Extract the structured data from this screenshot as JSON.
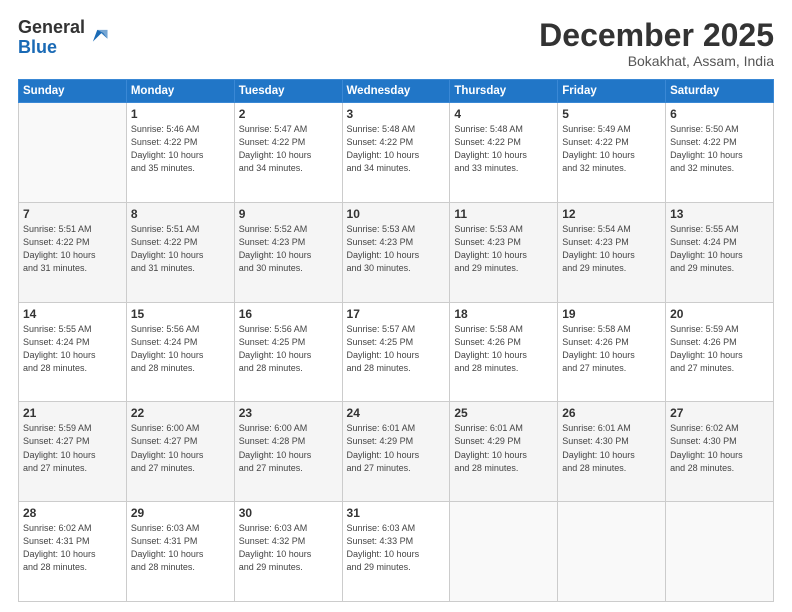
{
  "logo": {
    "general": "General",
    "blue": "Blue"
  },
  "header": {
    "month": "December 2025",
    "location": "Bokakhat, Assam, India"
  },
  "weekdays": [
    "Sunday",
    "Monday",
    "Tuesday",
    "Wednesday",
    "Thursday",
    "Friday",
    "Saturday"
  ],
  "weeks": [
    [
      {
        "day": "",
        "info": ""
      },
      {
        "day": "1",
        "info": "Sunrise: 5:46 AM\nSunset: 4:22 PM\nDaylight: 10 hours\nand 35 minutes."
      },
      {
        "day": "2",
        "info": "Sunrise: 5:47 AM\nSunset: 4:22 PM\nDaylight: 10 hours\nand 34 minutes."
      },
      {
        "day": "3",
        "info": "Sunrise: 5:48 AM\nSunset: 4:22 PM\nDaylight: 10 hours\nand 34 minutes."
      },
      {
        "day": "4",
        "info": "Sunrise: 5:48 AM\nSunset: 4:22 PM\nDaylight: 10 hours\nand 33 minutes."
      },
      {
        "day": "5",
        "info": "Sunrise: 5:49 AM\nSunset: 4:22 PM\nDaylight: 10 hours\nand 32 minutes."
      },
      {
        "day": "6",
        "info": "Sunrise: 5:50 AM\nSunset: 4:22 PM\nDaylight: 10 hours\nand 32 minutes."
      }
    ],
    [
      {
        "day": "7",
        "info": "Sunrise: 5:51 AM\nSunset: 4:22 PM\nDaylight: 10 hours\nand 31 minutes."
      },
      {
        "day": "8",
        "info": "Sunrise: 5:51 AM\nSunset: 4:22 PM\nDaylight: 10 hours\nand 31 minutes."
      },
      {
        "day": "9",
        "info": "Sunrise: 5:52 AM\nSunset: 4:23 PM\nDaylight: 10 hours\nand 30 minutes."
      },
      {
        "day": "10",
        "info": "Sunrise: 5:53 AM\nSunset: 4:23 PM\nDaylight: 10 hours\nand 30 minutes."
      },
      {
        "day": "11",
        "info": "Sunrise: 5:53 AM\nSunset: 4:23 PM\nDaylight: 10 hours\nand 29 minutes."
      },
      {
        "day": "12",
        "info": "Sunrise: 5:54 AM\nSunset: 4:23 PM\nDaylight: 10 hours\nand 29 minutes."
      },
      {
        "day": "13",
        "info": "Sunrise: 5:55 AM\nSunset: 4:24 PM\nDaylight: 10 hours\nand 29 minutes."
      }
    ],
    [
      {
        "day": "14",
        "info": "Sunrise: 5:55 AM\nSunset: 4:24 PM\nDaylight: 10 hours\nand 28 minutes."
      },
      {
        "day": "15",
        "info": "Sunrise: 5:56 AM\nSunset: 4:24 PM\nDaylight: 10 hours\nand 28 minutes."
      },
      {
        "day": "16",
        "info": "Sunrise: 5:56 AM\nSunset: 4:25 PM\nDaylight: 10 hours\nand 28 minutes."
      },
      {
        "day": "17",
        "info": "Sunrise: 5:57 AM\nSunset: 4:25 PM\nDaylight: 10 hours\nand 28 minutes."
      },
      {
        "day": "18",
        "info": "Sunrise: 5:58 AM\nSunset: 4:26 PM\nDaylight: 10 hours\nand 28 minutes."
      },
      {
        "day": "19",
        "info": "Sunrise: 5:58 AM\nSunset: 4:26 PM\nDaylight: 10 hours\nand 27 minutes."
      },
      {
        "day": "20",
        "info": "Sunrise: 5:59 AM\nSunset: 4:26 PM\nDaylight: 10 hours\nand 27 minutes."
      }
    ],
    [
      {
        "day": "21",
        "info": "Sunrise: 5:59 AM\nSunset: 4:27 PM\nDaylight: 10 hours\nand 27 minutes."
      },
      {
        "day": "22",
        "info": "Sunrise: 6:00 AM\nSunset: 4:27 PM\nDaylight: 10 hours\nand 27 minutes."
      },
      {
        "day": "23",
        "info": "Sunrise: 6:00 AM\nSunset: 4:28 PM\nDaylight: 10 hours\nand 27 minutes."
      },
      {
        "day": "24",
        "info": "Sunrise: 6:01 AM\nSunset: 4:29 PM\nDaylight: 10 hours\nand 27 minutes."
      },
      {
        "day": "25",
        "info": "Sunrise: 6:01 AM\nSunset: 4:29 PM\nDaylight: 10 hours\nand 28 minutes."
      },
      {
        "day": "26",
        "info": "Sunrise: 6:01 AM\nSunset: 4:30 PM\nDaylight: 10 hours\nand 28 minutes."
      },
      {
        "day": "27",
        "info": "Sunrise: 6:02 AM\nSunset: 4:30 PM\nDaylight: 10 hours\nand 28 minutes."
      }
    ],
    [
      {
        "day": "28",
        "info": "Sunrise: 6:02 AM\nSunset: 4:31 PM\nDaylight: 10 hours\nand 28 minutes."
      },
      {
        "day": "29",
        "info": "Sunrise: 6:03 AM\nSunset: 4:31 PM\nDaylight: 10 hours\nand 28 minutes."
      },
      {
        "day": "30",
        "info": "Sunrise: 6:03 AM\nSunset: 4:32 PM\nDaylight: 10 hours\nand 29 minutes."
      },
      {
        "day": "31",
        "info": "Sunrise: 6:03 AM\nSunset: 4:33 PM\nDaylight: 10 hours\nand 29 minutes."
      },
      {
        "day": "",
        "info": ""
      },
      {
        "day": "",
        "info": ""
      },
      {
        "day": "",
        "info": ""
      }
    ]
  ]
}
